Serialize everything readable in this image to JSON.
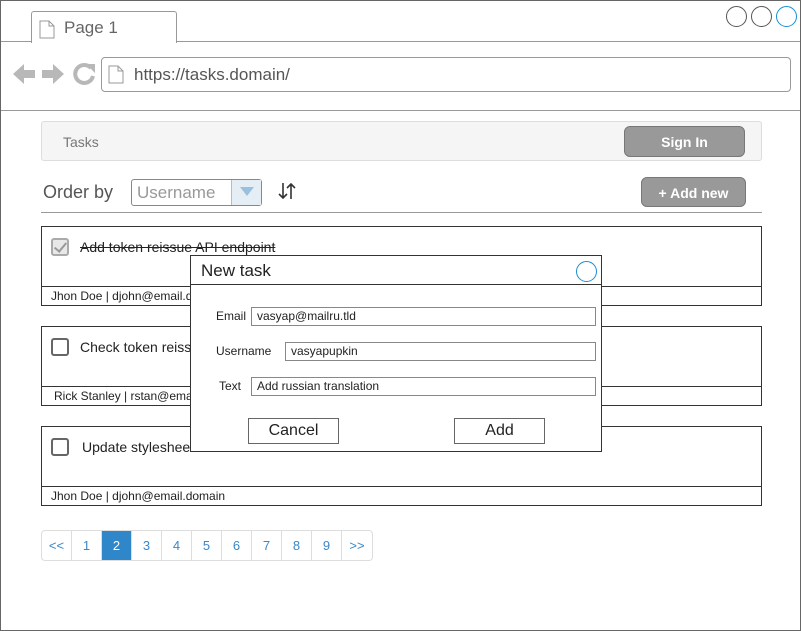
{
  "browser": {
    "tab_title": "Page 1",
    "url": "https://tasks.domain/"
  },
  "navbar": {
    "brand": "Tasks",
    "signin_label": "Sign In"
  },
  "toolbar": {
    "order_label": "Order by",
    "order_value": "Username",
    "add_new_label": "+ Add new"
  },
  "tasks": [
    {
      "title": "Add token reissue API endpoint",
      "done": true,
      "author": "Jhon Doe | djohn@email.domain"
    },
    {
      "title": "Check token reissue",
      "done": false,
      "author": "Rick Stanley | rstan@email.domain"
    },
    {
      "title": "Update stylesheet",
      "done": false,
      "author": "Jhon Doe | djohn@email.domain"
    }
  ],
  "pagination": {
    "pages": [
      "<<",
      "1",
      "2",
      "3",
      "4",
      "5",
      "6",
      "7",
      "8",
      "9",
      ">>"
    ],
    "active": "2"
  },
  "modal": {
    "title": "New task",
    "email_label": "Email",
    "email_value": "vasyap@mailru.tld",
    "username_label": "Username",
    "username_value": "vasyapupkin",
    "text_label": "Text",
    "text_value": "Add russian translation",
    "cancel_label": "Cancel",
    "add_label": "Add"
  },
  "colors": {
    "accent": "#2f86c8",
    "button_gray": "#999999"
  }
}
